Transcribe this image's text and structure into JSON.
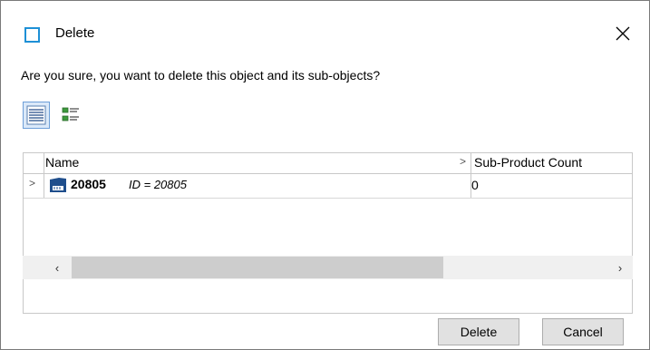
{
  "dialog": {
    "title": "Delete",
    "title_icon": "window-square-icon",
    "close_icon": "close-icon",
    "question": "Are you sure, you want to delete this object and its sub-objects?"
  },
  "toolbar": {
    "views": [
      {
        "icon": "list-view-icon",
        "active": true
      },
      {
        "icon": "details-view-icon",
        "active": false
      }
    ]
  },
  "grid": {
    "columns": [
      "Name",
      "Sub-Product Count"
    ],
    "rows": [
      {
        "name": "20805",
        "id_text": "ID = 20805",
        "sub_product_count": "0",
        "icon": "product-icon"
      }
    ]
  },
  "scrollbar": {
    "left_arrow": "‹",
    "right_arrow": "›"
  },
  "buttons": {
    "delete_label": "Delete",
    "cancel_label": "Cancel"
  },
  "colors": {
    "accent": "#1e90d6",
    "icon_blue": "#1f4e8c"
  }
}
